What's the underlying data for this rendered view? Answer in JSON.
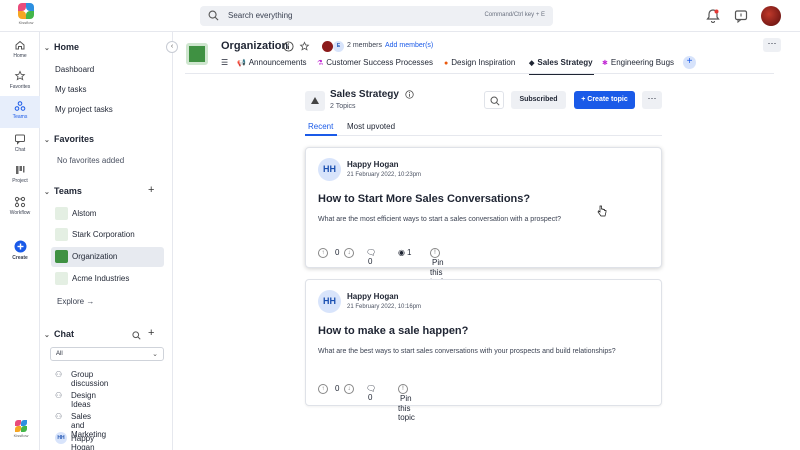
{
  "app": {
    "logo_text": "Kissflow"
  },
  "search": {
    "placeholder": "Search everything",
    "shortcut": "Command/Ctrl key + E"
  },
  "rail": {
    "items": [
      {
        "label": "Home",
        "icon": "home-icon"
      },
      {
        "label": "Favorites",
        "icon": "star-icon"
      },
      {
        "label": "Teams",
        "icon": "teams-icon",
        "active": true
      },
      {
        "label": "Chat",
        "icon": "chat-icon"
      },
      {
        "label": "Project",
        "icon": "project-icon"
      },
      {
        "label": "Workflow",
        "icon": "workflow-icon"
      },
      {
        "label": "Create",
        "icon": "create-icon"
      }
    ]
  },
  "sidebar": {
    "home": {
      "title": "Home",
      "items": [
        "Dashboard",
        "My tasks",
        "My project tasks"
      ]
    },
    "favorites": {
      "title": "Favorites",
      "empty": "No favorites added"
    },
    "teams": {
      "title": "Teams",
      "items": [
        "Alstom",
        "Stark Corporation",
        "Organization",
        "Acme Industries"
      ],
      "active": "Organization",
      "explore": "Explore"
    },
    "chat": {
      "title": "Chat",
      "filter": "All",
      "items": [
        "Group discussion",
        "Design Ideas",
        "Sales and Marketing",
        "Happy Hogan"
      ],
      "dm_initials": "HH"
    }
  },
  "org": {
    "title": "Organization",
    "member_initial": "E",
    "members": "2 members",
    "add_member": "Add member(s)",
    "tabs": [
      {
        "label": "Announcements",
        "icon": "megaphone-icon"
      },
      {
        "label": "Customer Success Processes",
        "icon": "flask-icon"
      },
      {
        "label": "Design Inspiration",
        "icon": "design-icon"
      },
      {
        "label": "Sales Strategy",
        "icon": "sales-icon",
        "active": true
      },
      {
        "label": "Engineering Bugs",
        "icon": "bug-icon"
      }
    ]
  },
  "channel": {
    "title": "Sales Strategy",
    "topic_count": "2 Topics",
    "subscribed_label": "Subscribed",
    "create_label": "+ Create topic",
    "tabs": [
      "Recent",
      "Most upvoted"
    ]
  },
  "topics": [
    {
      "initials": "HH",
      "author": "Happy Hogan",
      "date": "21 February 2022, 10:23pm",
      "title": "How to Start More Sales Conversations?",
      "body": "What are the most efficient ways to start a sales conversation with a prospect?",
      "votes": "0",
      "comments": "0",
      "views": "1",
      "pin_label": "Pin this topic"
    },
    {
      "initials": "HH",
      "author": "Happy Hogan",
      "date": "21 February 2022, 10:16pm",
      "title": "How to make a sale happen?",
      "body": "What are the best ways to start sales conversations with your prospects and build relationships?",
      "votes": "0",
      "comments": "0",
      "pin_label": "Pin this topic"
    }
  ],
  "colors": {
    "accent": "#1a5ae8",
    "org_green": "#3f9142",
    "active_bg": "#e7eefb"
  }
}
